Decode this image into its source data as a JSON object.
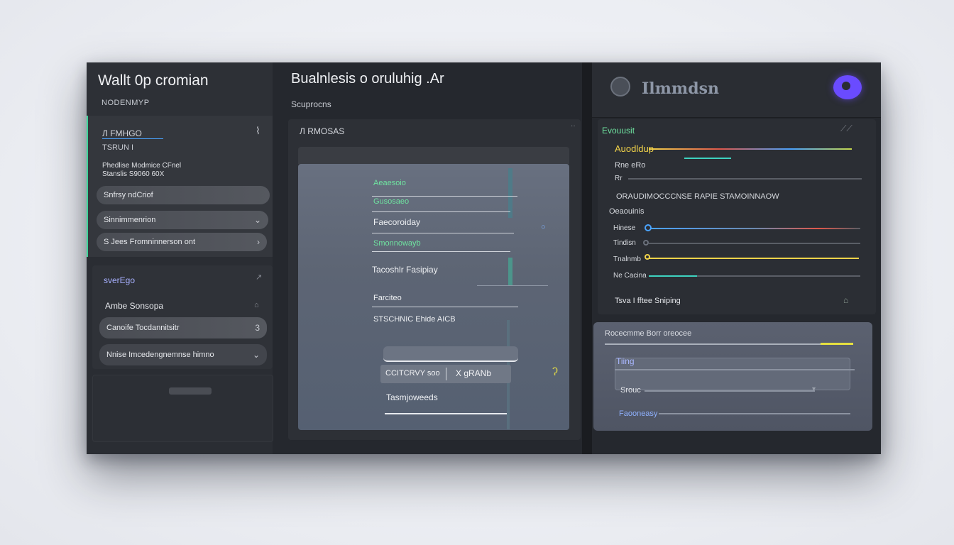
{
  "app": {
    "title": "Wallt 0p cromian",
    "subtitle": "NODENMYP"
  },
  "left": {
    "section1": {
      "link": "Л FMHGO",
      "label": "TSRUN I",
      "desc_line1": "Phedlise Modmice CFnel",
      "desc_line2": "Stanslis S9060 60X",
      "items": [
        {
          "label": "Snfrsy ndCriof"
        },
        {
          "label": "Sinnimmenrion"
        },
        {
          "label": "S Jees Fromninnerson ont"
        }
      ]
    },
    "section2": {
      "heading": "sverEgo",
      "items": [
        {
          "label": "Ambe Sonsopa"
        },
        {
          "label": "Canoife Tocdannitsitr"
        },
        {
          "label": "Nnise Imcedengnemnse himno"
        }
      ]
    }
  },
  "middle": {
    "title": "Bualnlesis o oruluhig .Ar",
    "subtitle": "Scuprocns",
    "panel_breadcrumb": "Л RMOSAS",
    "screen": {
      "lines": [
        "Aeaesoio",
        "Gusosaeo",
        "Faecoroiday",
        "Smonnowayb",
        "Tacoshlr Fasipiay",
        "Farciteo",
        "STSCHNIC Ehide AICB"
      ],
      "input_value": "Tasmjoweeds",
      "segment_left": "CCITCRVY soo",
      "segment_right": "X gRANb"
    }
  },
  "right": {
    "brand": "Ilmmdsn",
    "panel": {
      "heading": "Evouusit",
      "rows": [
        {
          "label": "Auodldup"
        },
        {
          "label": "Rne eRo"
        },
        {
          "label": "Rr"
        }
      ],
      "banner": "ORAUDIMOCCCNSE RAPIE STAMOINNAOW",
      "sub_heading": "Oeaouinis",
      "sliders": [
        {
          "label": "Hinese",
          "value": 0.02
        },
        {
          "label": "Tindisn",
          "value": 0.0
        },
        {
          "label": "Tnalnmb",
          "value": 0.0
        },
        {
          "label": "Ne Cacina",
          "value": 0.25
        }
      ],
      "footer": "Tsva I fftee Sniping"
    },
    "card": {
      "heading": "Rocecmme Borr oreocee",
      "field1": "Tiing",
      "field2": "Srouc",
      "field3": "Faooneasy"
    }
  },
  "colors": {
    "accent_green": "#3ed39a",
    "accent_blue": "#4aa3ff",
    "accent_yellow": "#f1d34a",
    "accent_red": "#e0584b",
    "avatar_purple": "#6a4bff"
  }
}
